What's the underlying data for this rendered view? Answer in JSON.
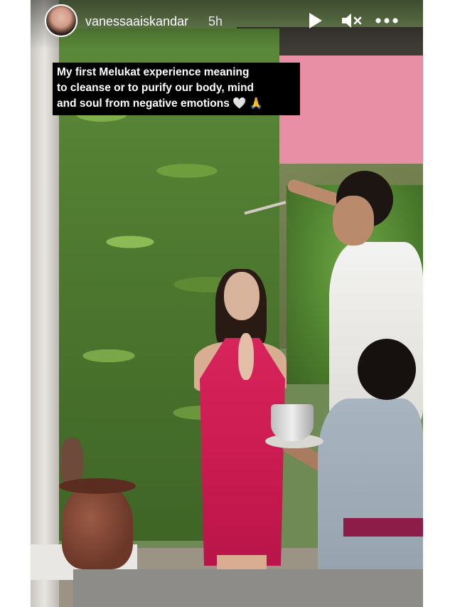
{
  "story": {
    "username": "vanessaaiskandar",
    "time_ago": "5h",
    "avatar_icon": "profile-avatar",
    "controls": {
      "play_icon": "play-icon",
      "mute_icon": "mute-icon",
      "more_icon": "more-icon"
    },
    "caption": {
      "line1": "My first Melukat experience meaning",
      "line2": "to cleanse or  to purify our body, mind",
      "line3": "and soul from negative emotions 🤍 🙏"
    }
  },
  "colors": {
    "caption_bg": "#000000",
    "caption_text": "#ffffff",
    "dress": "#d8245c"
  }
}
